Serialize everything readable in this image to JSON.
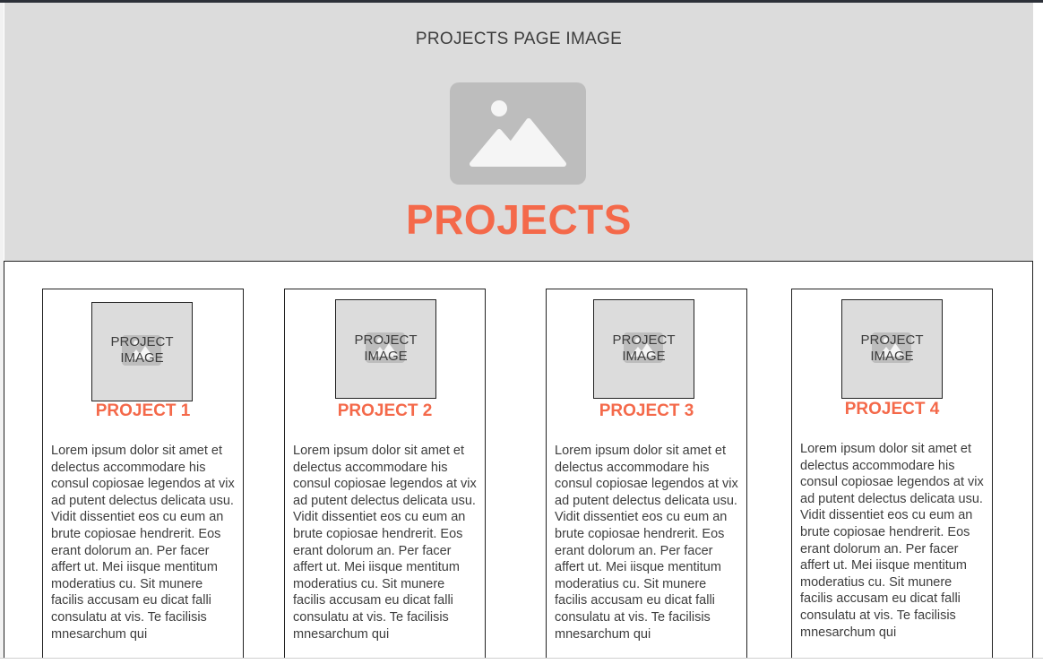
{
  "hero": {
    "image_label": "PROJECTS PAGE IMAGE",
    "icon": "image-placeholder-icon",
    "title": "PROJECTS"
  },
  "colors": {
    "accent": "#f4694a",
    "placeholder_bg": "#dcdcdc",
    "placeholder_icon": "#bdbdbd",
    "text": "#3d3d3d"
  },
  "projects": [
    {
      "image_label_line1": "PROJECT",
      "image_label_line2": "IMAGE",
      "title": "PROJECT 1",
      "description": "Lorem ipsum dolor sit amet et delectus accommodare his consul copiosae legendos at vix ad putent delectus delicata usu. Vidit dissentiet eos cu eum an brute copiosae hendrerit. Eos erant dolorum an. Per facer affert ut. Mei iisque mentitum moderatius cu. Sit munere facilis accusam eu dicat falli consulatu at vis. Te facilisis mnesarchum qui"
    },
    {
      "image_label_line1": "PROJECT",
      "image_label_line2": "IMAGE",
      "title": "PROJECT 2",
      "description": "Lorem ipsum dolor sit amet et delectus accommodare his consul copiosae legendos at vix ad putent delectus delicata usu. Vidit dissentiet eos cu eum an brute copiosae hendrerit. Eos erant dolorum an. Per facer affert ut. Mei iisque mentitum moderatius cu. Sit munere facilis accusam eu dicat falli consulatu at vis. Te facilisis mnesarchum qui"
    },
    {
      "image_label_line1": "PROJECT",
      "image_label_line2": "IMAGE",
      "title": "PROJECT 3",
      "description": "Lorem ipsum dolor sit amet et delectus accommodare his consul copiosae legendos at vix ad putent delectus delicata usu. Vidit dissentiet eos cu eum an brute copiosae hendrerit. Eos erant dolorum an. Per facer affert ut. Mei iisque mentitum moderatius cu. Sit munere facilis accusam eu dicat falli consulatu at vis. Te facilisis mnesarchum qui"
    },
    {
      "image_label_line1": "PROJECT",
      "image_label_line2": "IMAGE",
      "title": "PROJECT 4",
      "description": "Lorem ipsum dolor sit amet et delectus accommodare his consul copiosae legendos at vix ad putent delectus delicata usu. Vidit dissentiet eos cu eum an brute copiosae hendrerit. Eos erant dolorum an. Per facer affert ut. Mei iisque mentitum moderatius cu. Sit munere facilis accusam eu dicat falli consulatu at vis. Te facilisis mnesarchum qui"
    }
  ]
}
